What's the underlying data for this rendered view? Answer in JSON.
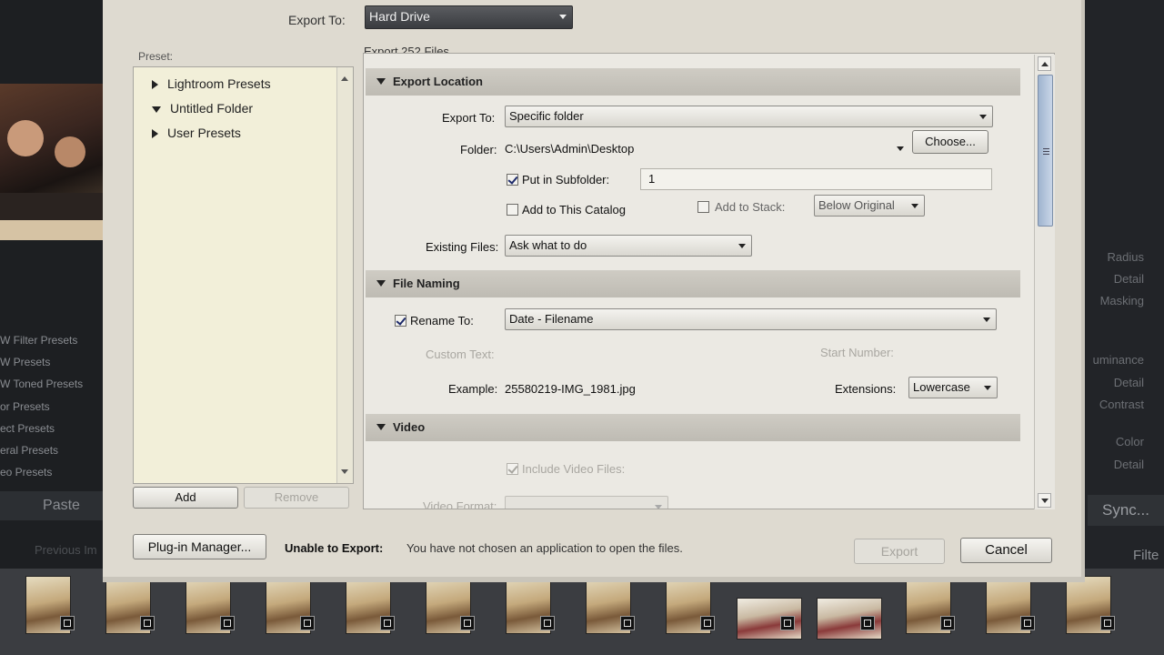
{
  "background": {
    "left_panel_items": [
      "W Filter Presets",
      "W Presets",
      "W Toned Presets",
      "or Presets",
      "ect Presets",
      "eral Presets",
      "eo Presets"
    ],
    "paste_label": "Paste",
    "previous_import_label": "Previous Im",
    "right_panel_items": [
      "Radius",
      "Detail",
      "Masking",
      "uminance",
      "Detail",
      "Contrast",
      "Color",
      "Detail"
    ],
    "sync_label": "Sync...",
    "filter_label": "Filte"
  },
  "dialog": {
    "export_to_label": "Export To:",
    "export_to_value": "Hard Drive",
    "preset_label": "Preset:",
    "export_count": "Export 252 Files",
    "presets": [
      {
        "label": "Lightroom Presets",
        "expanded": false
      },
      {
        "label": "Untitled Folder",
        "expanded": true
      },
      {
        "label": "User Presets",
        "expanded": false
      }
    ],
    "add_button": "Add",
    "remove_button": "Remove",
    "plugin_manager_button": "Plug-in Manager...",
    "status_title": "Unable to Export:",
    "status_message": "You have not chosen an application to open the files.",
    "export_button": "Export",
    "cancel_button": "Cancel"
  },
  "export_location": {
    "header": "Export Location",
    "export_to_label": "Export To:",
    "export_to_value": "Specific folder",
    "folder_label": "Folder:",
    "folder_path": "C:\\Users\\Admin\\Desktop",
    "choose_button": "Choose...",
    "subfolder_label": "Put in Subfolder:",
    "subfolder_checked": true,
    "subfolder_value": "1",
    "catalog_label": "Add to This Catalog",
    "catalog_checked": false,
    "stack_label": "Add to Stack:",
    "stack_checked": false,
    "stack_value": "Below Original",
    "existing_label": "Existing Files:",
    "existing_value": "Ask what to do"
  },
  "file_naming": {
    "header": "File Naming",
    "rename_label": "Rename To:",
    "rename_checked": true,
    "rename_value": "Date - Filename",
    "custom_text_label": "Custom Text:",
    "start_number_label": "Start Number:",
    "example_label": "Example:",
    "example_value": "25580219-IMG_1981.jpg",
    "extensions_label": "Extensions:",
    "extensions_value": "Lowercase"
  },
  "video": {
    "header": "Video",
    "include_label": "Include Video Files:",
    "include_checked": true,
    "format_label": "Video Format:"
  }
}
